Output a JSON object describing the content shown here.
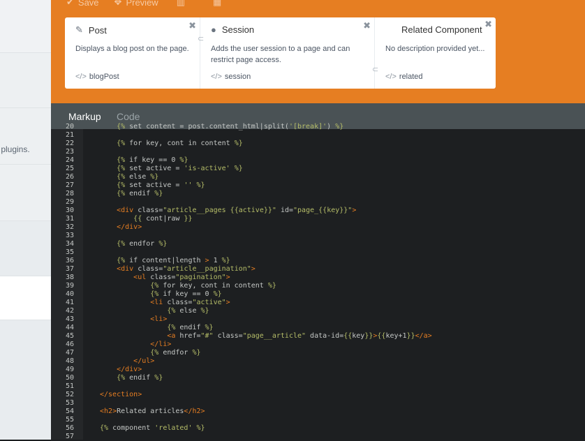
{
  "sidebar": {
    "hint_text": "r plugins."
  },
  "toolbar": {
    "items": [
      {
        "label": "Save",
        "icon": "check-icon"
      },
      {
        "label": "Preview",
        "icon": "move-icon"
      },
      {
        "label": "",
        "icon": "trash-icon"
      },
      {
        "label": "",
        "icon": "table-icon"
      }
    ]
  },
  "components": [
    {
      "title": "Post",
      "icon": "pencil-icon",
      "description": "Displays a blog post on the page.",
      "alias": "blogPost"
    },
    {
      "title": "Session",
      "icon": "user-icon",
      "description": "Adds the user session to a page and can restrict page access.",
      "alias": "session"
    },
    {
      "title": "Related Component",
      "icon": "",
      "description": "No description provided yet...",
      "alias": "related"
    }
  ],
  "tabs": [
    {
      "label": "Markup",
      "active": true
    },
    {
      "label": "Code",
      "active": false
    }
  ],
  "editor": {
    "lines": [
      {
        "n": "20",
        "text": "    {% set content = post.content_html|split('[break]') %}"
      },
      {
        "n": "21",
        "text": ""
      },
      {
        "n": "22",
        "text": "    {% for key, cont in content %}"
      },
      {
        "n": "23",
        "text": ""
      },
      {
        "n": "24",
        "text": "    {% if key == 0 %}"
      },
      {
        "n": "25",
        "text": "    {% set active = 'is-active' %}"
      },
      {
        "n": "26",
        "text": "    {% else %}"
      },
      {
        "n": "27",
        "text": "    {% set active = '' %}"
      },
      {
        "n": "28",
        "text": "    {% endif %}"
      },
      {
        "n": "29",
        "text": ""
      },
      {
        "n": "30",
        "text": "    <div class=\"article__pages {{active}}\" id=\"page_{{key}}\">"
      },
      {
        "n": "31",
        "text": "        {{ cont|raw }}"
      },
      {
        "n": "32",
        "text": "    </div>"
      },
      {
        "n": "33",
        "text": ""
      },
      {
        "n": "34",
        "text": "    {% endfor %}"
      },
      {
        "n": "35",
        "text": ""
      },
      {
        "n": "36",
        "text": "    {% if content|length > 1 %}"
      },
      {
        "n": "37",
        "text": "    <div class=\"article__pagination\">"
      },
      {
        "n": "38",
        "text": "        <ul class=\"pagination\">"
      },
      {
        "n": "39",
        "text": "            {% for key, cont in content %}"
      },
      {
        "n": "40",
        "text": "            {% if key == 0 %}"
      },
      {
        "n": "41",
        "text": "            <li class=\"active\">"
      },
      {
        "n": "42",
        "text": "                {% else %}"
      },
      {
        "n": "43",
        "text": "            <li>"
      },
      {
        "n": "44",
        "text": "                {% endif %}"
      },
      {
        "n": "45",
        "text": "                <a href=\"#\" class=\"page__article\" data-id={{key}}>{{key+1}}</a>"
      },
      {
        "n": "46",
        "text": "            </li>"
      },
      {
        "n": "47",
        "text": "            {% endfor %}"
      },
      {
        "n": "48",
        "text": "        </ul>"
      },
      {
        "n": "49",
        "text": "    </div>"
      },
      {
        "n": "50",
        "text": "    {% endif %}"
      },
      {
        "n": "51",
        "text": ""
      },
      {
        "n": "52",
        "text": "</section>"
      },
      {
        "n": "53",
        "text": ""
      },
      {
        "n": "54",
        "text": "<h2>Related articles</h2>"
      },
      {
        "n": "55",
        "text": ""
      },
      {
        "n": "56",
        "text": "{% component 'related' %}"
      },
      {
        "n": "57",
        "text": ""
      }
    ]
  },
  "colors": {
    "accent": "#e67e22",
    "tabs_bg": "#4a5255",
    "editor_bg": "#1d1f21",
    "gutter_bg": "#252729",
    "tab_active": "#ffffff",
    "tab_inactive": "#9aa3a7"
  }
}
